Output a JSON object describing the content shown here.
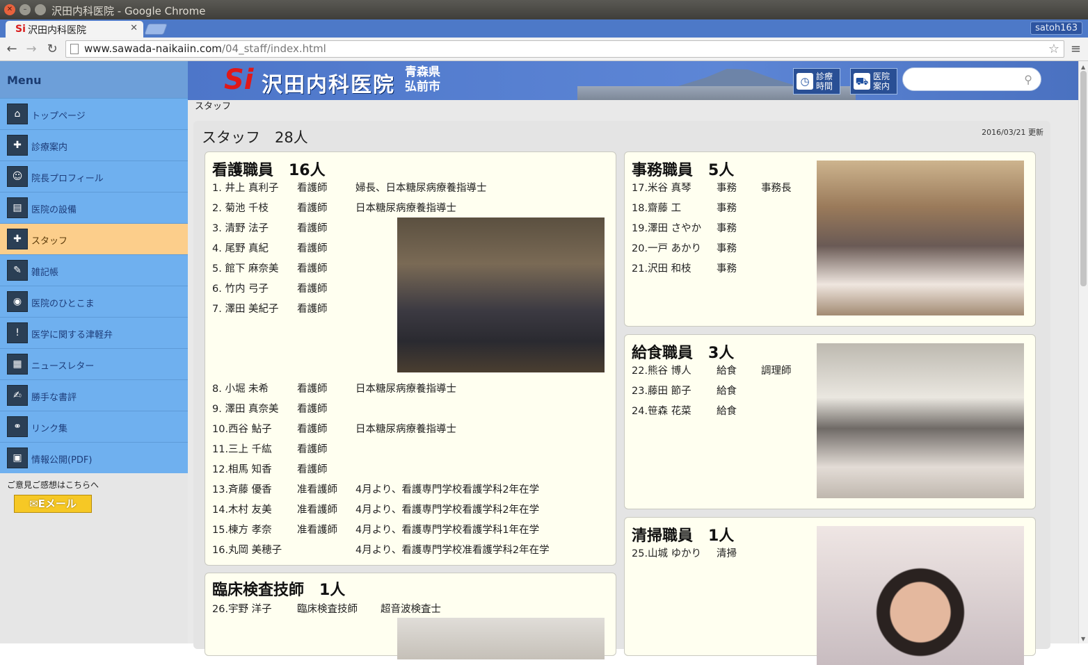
{
  "window": {
    "title": "沢田内科医院 - Google Chrome",
    "user": "satoh163"
  },
  "tab": {
    "title": "沢田内科医院",
    "favicon": "Si"
  },
  "address": {
    "host": "www.sawada-naikaiin.com",
    "path": "/04_staff/index.html"
  },
  "sidebar": {
    "heading": "Menu",
    "items": [
      {
        "label": "トップページ",
        "icon": "home-icon"
      },
      {
        "label": "診療案内",
        "icon": "clinic-guide-icon"
      },
      {
        "label": "院長プロフィール",
        "icon": "doctor-profile-icon"
      },
      {
        "label": "医院の設備",
        "icon": "facility-icon"
      },
      {
        "label": "スタッフ",
        "icon": "staff-icon",
        "active": true
      },
      {
        "label": "雑記帳",
        "icon": "notebook-icon"
      },
      {
        "label": "医院のひとこま",
        "icon": "snapshot-icon"
      },
      {
        "label": "医学に関する津軽弁",
        "icon": "dialect-icon"
      },
      {
        "label": "ニュースレター",
        "icon": "newsletter-icon"
      },
      {
        "label": "勝手な書評",
        "icon": "book-review-icon"
      },
      {
        "label": "リンク集",
        "icon": "links-icon"
      },
      {
        "label": "情報公開(PDF)",
        "icon": "disclosure-icon"
      }
    ],
    "feedback": "ご意見ご感想はこちらへ",
    "email_button": "Eメール"
  },
  "banner": {
    "logo_mark": "Si",
    "logo_text": "沢田内科医院",
    "pref": "青森県",
    "city": "弘前市",
    "btn_hours": {
      "l1": "診療",
      "l2": "時間"
    },
    "btn_guide": {
      "l1": "医院",
      "l2": "案内"
    }
  },
  "breadcrumb": "スタッフ",
  "page": {
    "title": "スタッフ　28人",
    "updated": "2016/03/21 更新"
  },
  "sections": {
    "nurses": {
      "title": "看護職員　16人",
      "rows": [
        {
          "name": " 1. 井上 真利子",
          "role": "看護師",
          "note": "婦長、日本糖尿病療養指導士"
        },
        {
          "name": " 2. 菊池 千枝",
          "role": "看護師",
          "note": "日本糖尿病療養指導士"
        },
        {
          "name": " 3. 清野 法子",
          "role": "看護師",
          "note": ""
        },
        {
          "name": " 4. 尾野 真紀",
          "role": "看護師",
          "note": ""
        },
        {
          "name": " 5. 館下 麻奈美",
          "role": "看護師",
          "note": ""
        },
        {
          "name": " 6. 竹内 弓子",
          "role": "看護師",
          "note": ""
        },
        {
          "name": " 7. 澤田 美紀子",
          "role": "看護師",
          "note": ""
        },
        {
          "name": " 8. 小堀 未希",
          "role": "看護師",
          "note": "日本糖尿病療養指導士"
        },
        {
          "name": " 9. 澤田 真奈美",
          "role": "看護師",
          "note": ""
        },
        {
          "name": "10.西谷 鮎子",
          "role": "看護師",
          "note": "日本糖尿病療養指導士"
        },
        {
          "name": "11.三上 千紘",
          "role": "看護師",
          "note": ""
        },
        {
          "name": "12.相馬 知香",
          "role": "看護師",
          "note": ""
        },
        {
          "name": "13.斉藤 優香",
          "role": "准看護師",
          "note": "4月より、看護専門学校看護学科2年在学"
        },
        {
          "name": "14.木村 友美",
          "role": "准看護師",
          "note": "4月より、看護専門学校看護学科2年在学"
        },
        {
          "name": "15.棟方 孝奈",
          "role": "准看護師",
          "note": "4月より、看護専門学校看護学科1年在学"
        },
        {
          "name": "16.丸岡 美穂子",
          "role": "",
          "note": "4月より、看護専門学校准看護学科2年在学"
        }
      ]
    },
    "office": {
      "title": "事務職員　5人",
      "rows": [
        {
          "name": "17.米谷 真琴",
          "role": "事務",
          "note": "事務長"
        },
        {
          "name": "18.齋藤 工",
          "role": "事務",
          "note": ""
        },
        {
          "name": "19.澤田 さやか",
          "role": "事務",
          "note": ""
        },
        {
          "name": "20.一戸 あかり",
          "role": "事務",
          "note": ""
        },
        {
          "name": "21.沢田 和枝",
          "role": "事務",
          "note": ""
        }
      ]
    },
    "kitchen": {
      "title": "給食職員　3人",
      "rows": [
        {
          "name": "22.熊谷 博人",
          "role": "給食",
          "note": "調理師"
        },
        {
          "name": "23.藤田 節子",
          "role": "給食",
          "note": ""
        },
        {
          "name": "24.笹森 花菜",
          "role": "給食",
          "note": ""
        }
      ]
    },
    "cleaning": {
      "title": "清掃職員　1人",
      "rows": [
        {
          "name": "25.山城 ゆかり",
          "role": "清掃",
          "note": ""
        }
      ]
    },
    "lab": {
      "title": "臨床検査技師　1人",
      "rows": [
        {
          "name": "26.宇野 洋子",
          "role": "臨床検査技師",
          "note": "超音波検査士"
        }
      ]
    }
  },
  "colors": {
    "sidebar": "#6fb0ef",
    "active": "#fcce8b",
    "banner": "#4d76c9",
    "card": "#fffff0"
  }
}
